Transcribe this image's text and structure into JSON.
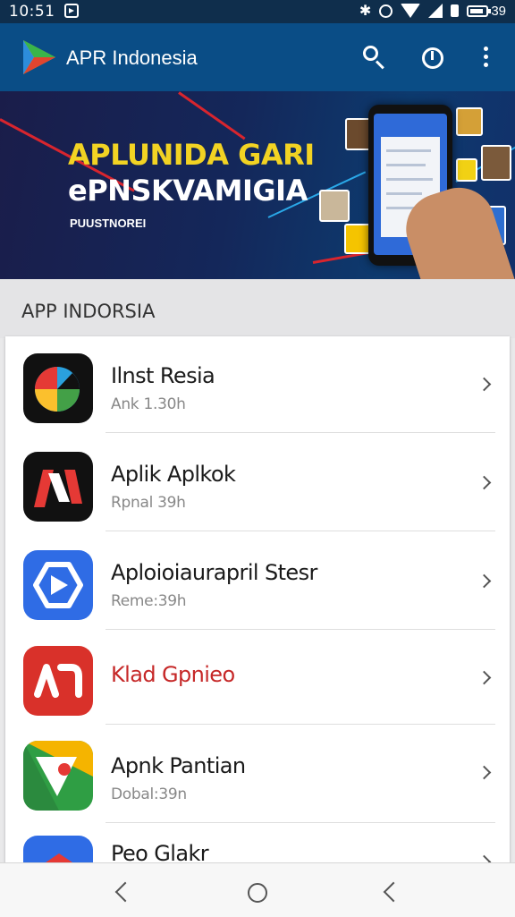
{
  "status_bar": {
    "time": "10:51",
    "battery": "39"
  },
  "app_bar": {
    "title": "APR Indonesia",
    "actions": [
      "search-icon",
      "timer-icon",
      "more-vert-icon"
    ]
  },
  "banner": {
    "headline_1": "APLUNIDA GARI",
    "headline_2": "ePNSKVAMIGIA",
    "subtext": "PUUSTNOREI"
  },
  "section": {
    "title": "APP INDORSIA"
  },
  "apps": [
    {
      "name": "Ilnst Resia",
      "meta": "Ank 1.30h"
    },
    {
      "name": "Aplik Aplkok",
      "meta": "Rpnal 39h"
    },
    {
      "name": "Aploioiaurapril Stesr",
      "meta": "Reme:39h"
    },
    {
      "name": "Klad Gpnieo",
      "meta": ""
    },
    {
      "name": "Apnk Pantian",
      "meta": "Dobal:39n"
    },
    {
      "name": "Peo Glakr",
      "meta": ""
    }
  ],
  "colors": {
    "app_bar": "#0a4d86",
    "status_bar": "#0f2e4c",
    "banner_yellow": "#f2d323",
    "red_title": "#c62828"
  }
}
